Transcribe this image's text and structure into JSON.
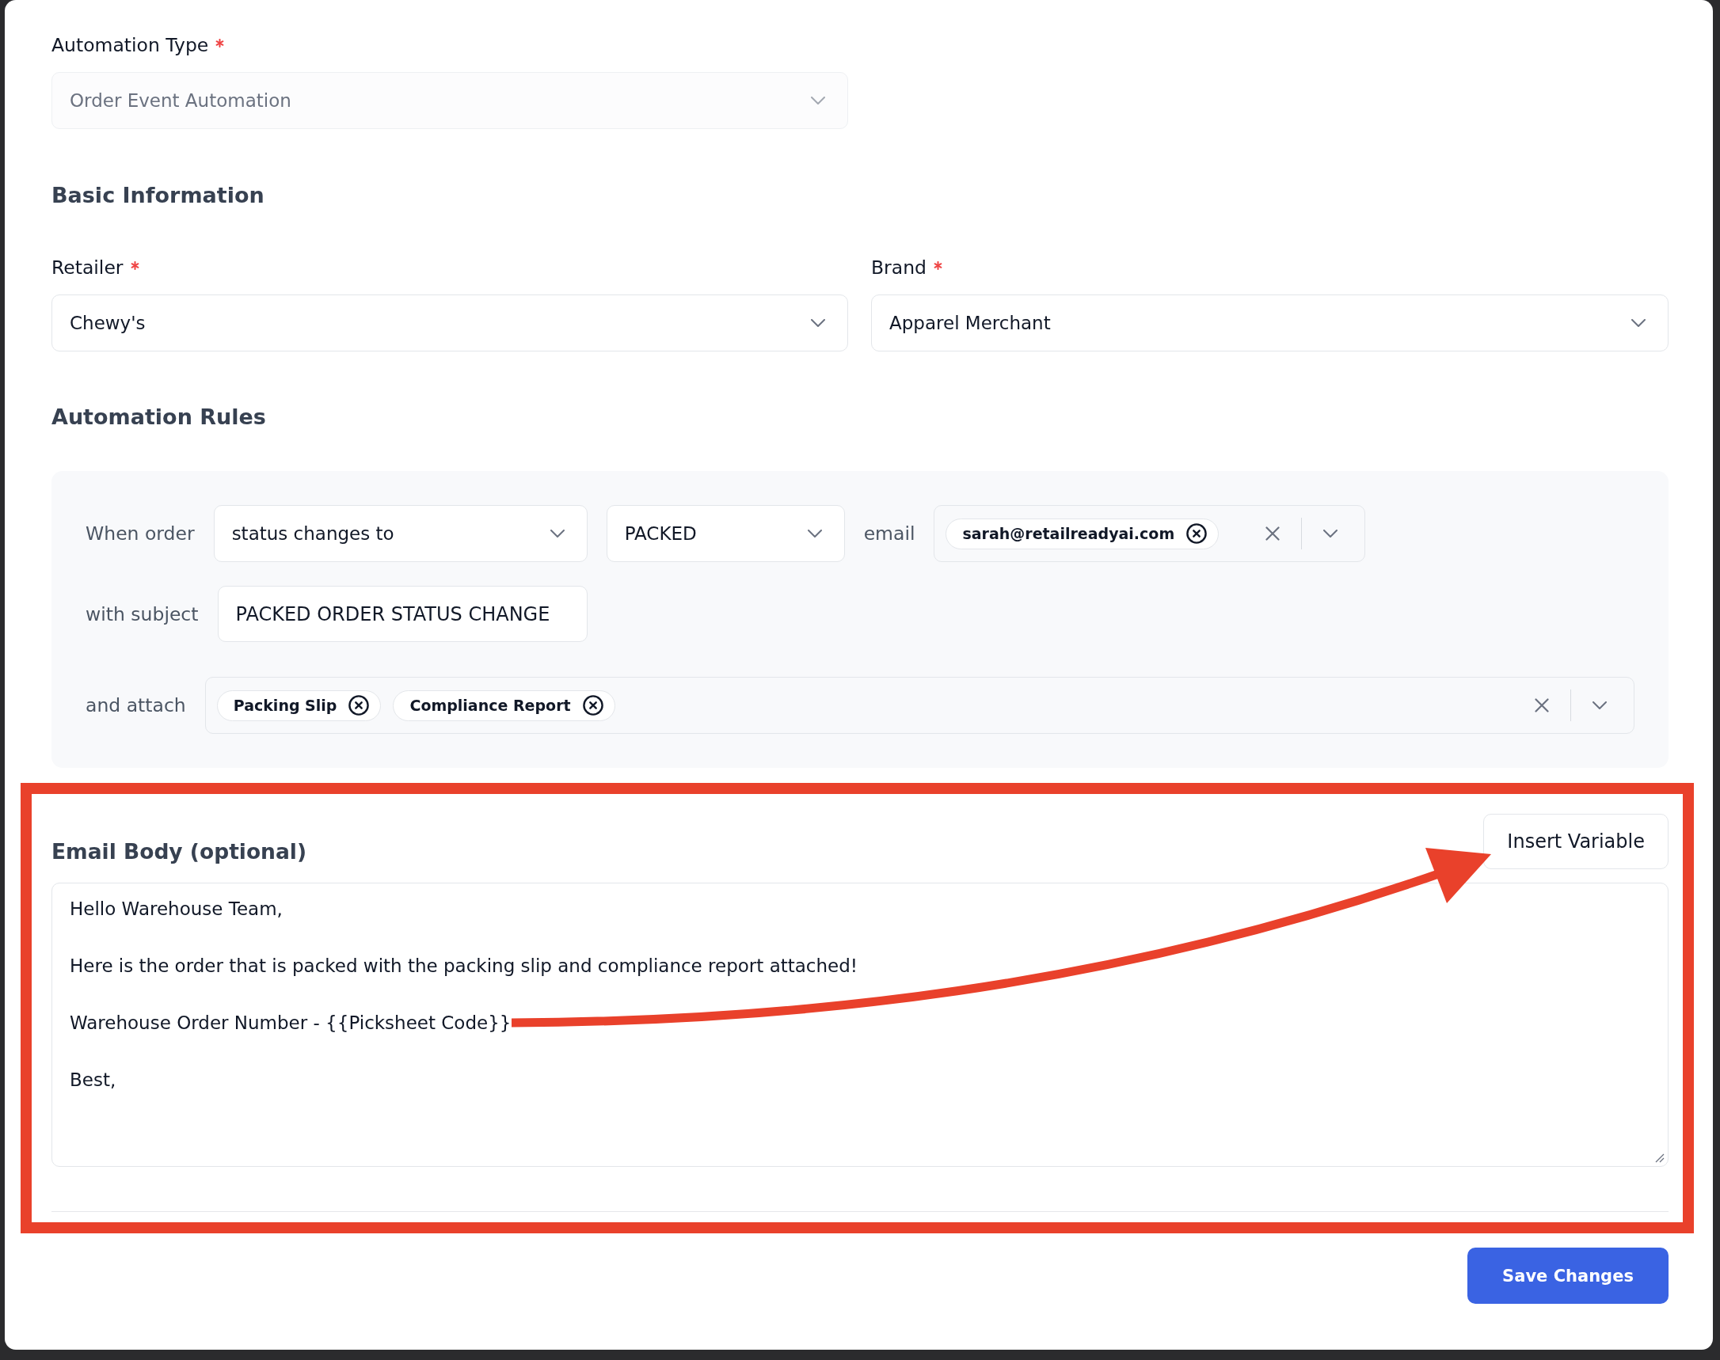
{
  "automation_type": {
    "label": "Automation Type",
    "required": true,
    "value": "Order Event Automation",
    "disabled": true
  },
  "basic_information": {
    "title": "Basic Information",
    "fields": [
      {
        "label": "Retailer",
        "required": true,
        "value": "Chewy's"
      },
      {
        "label": "Brand",
        "required": true,
        "value": "Apparel Merchant"
      }
    ]
  },
  "automation_rules": {
    "title": "Automation Rules",
    "rows": [
      {
        "items": [
          {
            "kind": "label",
            "text": "When order"
          },
          {
            "kind": "select",
            "value": "status changes to"
          },
          {
            "kind": "select",
            "value": "PACKED"
          },
          {
            "kind": "label",
            "text": "email"
          },
          {
            "kind": "multiselect",
            "chips": [
              "sarah@retailreadyai.com"
            ]
          }
        ]
      },
      {
        "items": [
          {
            "kind": "label",
            "text": "with subject"
          },
          {
            "kind": "input",
            "value": "PACKED ORDER STATUS CHANGE"
          }
        ]
      },
      {
        "items": [
          {
            "kind": "label",
            "text": "and attach"
          },
          {
            "kind": "multiselect",
            "chips": [
              "Packing Slip",
              "Compliance Report"
            ]
          }
        ]
      }
    ]
  },
  "email_body": {
    "title": "Email Body (optional)",
    "insert_button": "Insert Variable",
    "lines": [
      "Hello Warehouse Team,",
      "Here is the order that is packed with the packing slip and compliance report attached!",
      "Warehouse Order Number - {{Picksheet Code}}",
      "Best,"
    ]
  },
  "save_button": "Save Changes",
  "annotations": {
    "highlight_frame": true,
    "arrow": true
  }
}
